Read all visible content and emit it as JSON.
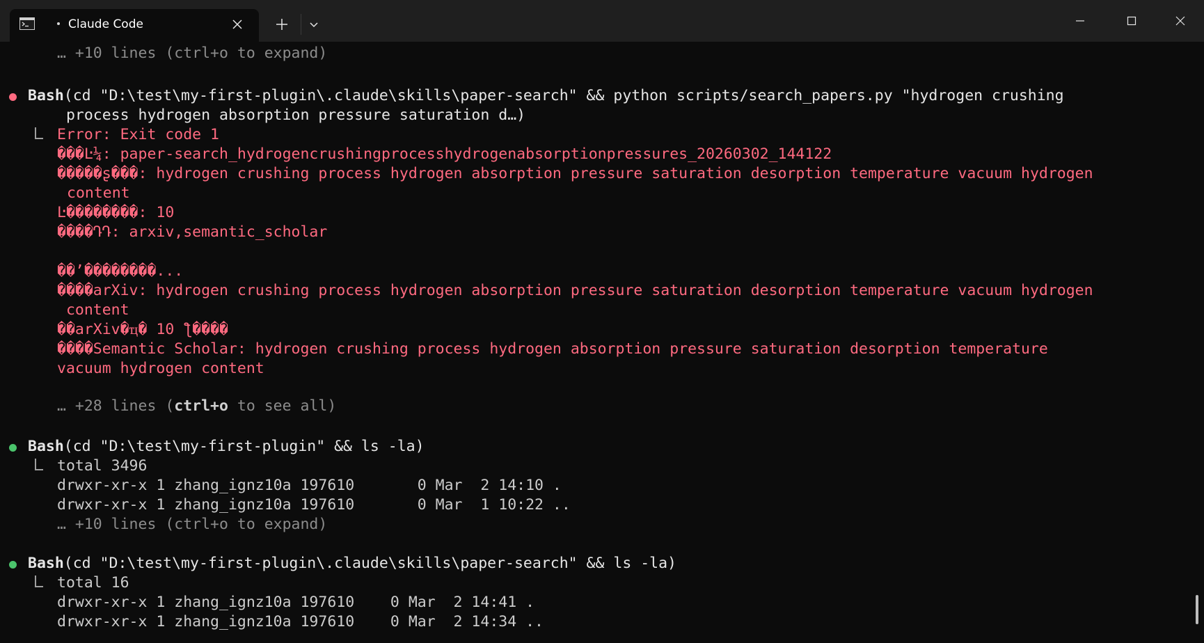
{
  "window": {
    "tab_title": "Claude Code",
    "icons": {
      "tab": "terminal-icon",
      "close_tab": "close-icon",
      "new_tab": "plus-icon",
      "dropdown": "chevron-down-icon",
      "minimize": "minimize-icon",
      "maximize": "maximize-icon",
      "close_window": "close-icon"
    }
  },
  "colors": {
    "error": "#ff6a80",
    "success": "#4bc46c",
    "background": "#0c0c0c",
    "dim_text": "#8c8c8c"
  },
  "terminal": {
    "top_collapsed": "… +10 lines (ctrl+o to expand)",
    "block1": {
      "status": "error",
      "tool": "Bash",
      "command_line1": "(cd \"D:\\test\\my-first-plugin\\.claude\\skills\\paper-search\" && python scripts/search_papers.py \"hydrogen crushing",
      "command_line2": " process hydrogen absorption pressure saturation d…)",
      "output": [
        "Error: Exit code 1",
        "���Ŀ¼: paper-search_hydrogencrushingprocesshydrogenabsorptionpressures_20260302_144122",
        "�����ʂ���: hydrogen crushing process hydrogen absorption pressure saturation desorption temperature vacuum hydrogen",
        "content",
        "Ŀ��������: 10",
        "����ԴԴ: arxiv,semantic_scholar",
        "",
        "��ʼ��������...",
        "����arXiv: hydrogen crushing process hydrogen absorption pressure saturation desorption temperature vacuum hydrogen",
        " content",
        "��arXiv�ҵ� 10 ƪ����",
        "����Semantic Scholar: hydrogen crushing process hydrogen absorption pressure saturation desorption temperature",
        "vacuum hydrogen content"
      ],
      "more_prefix": "… +28 lines (",
      "more_key": "ctrl+o",
      "more_suffix": " to see all)"
    },
    "block2": {
      "status": "success",
      "tool": "Bash",
      "command": "(cd \"D:\\test\\my-first-plugin\" && ls -la)",
      "output": [
        "total 3496",
        "drwxr-xr-x 1 zhang_ignz10a 197610       0 Mar  2 14:10 .",
        "drwxr-xr-x 1 zhang_ignz10a 197610       0 Mar  1 10:22 .."
      ],
      "collapsed": "… +10 lines (ctrl+o to expand)"
    },
    "block3": {
      "status": "success",
      "tool": "Bash",
      "command": "(cd \"D:\\test\\my-first-plugin\\.claude\\skills\\paper-search\" && ls -la)",
      "output": [
        "total 16",
        "drwxr-xr-x 1 zhang_ignz10a 197610    0 Mar  2 14:41 .",
        "drwxr-xr-x 1 zhang_ignz10a 197610    0 Mar  2 14:34 .."
      ]
    }
  }
}
